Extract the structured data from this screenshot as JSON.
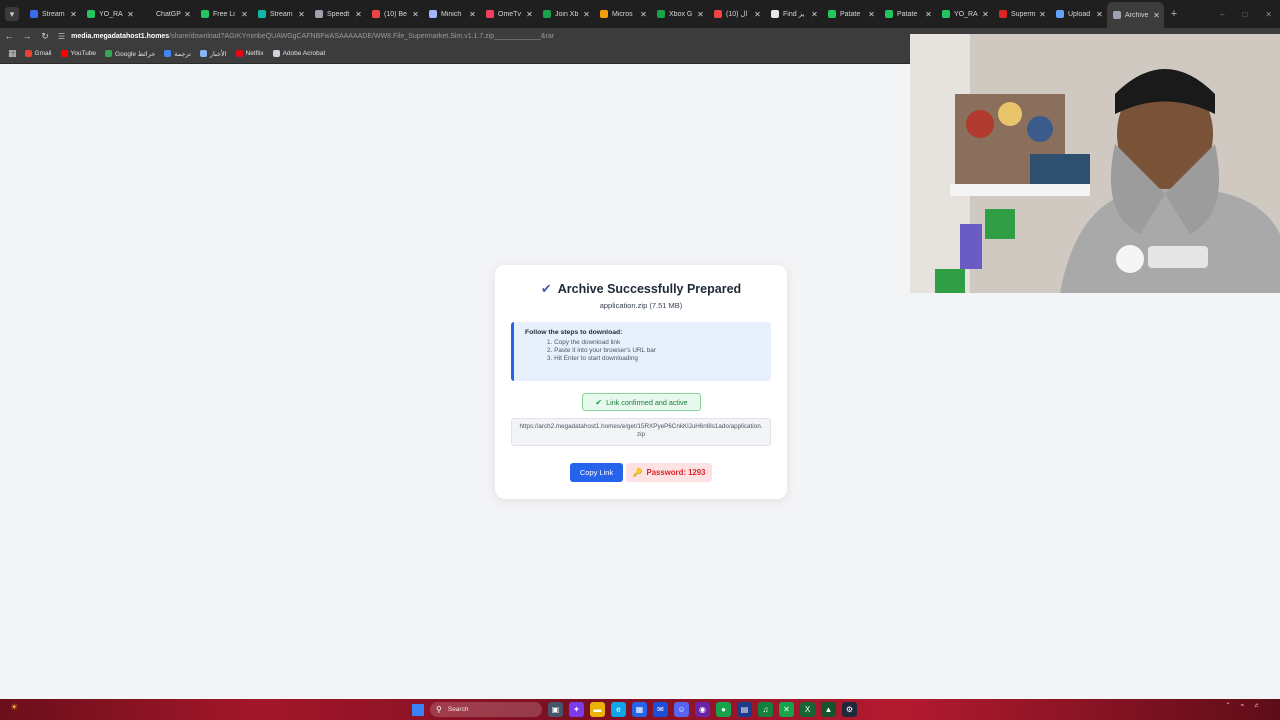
{
  "browser": {
    "tabs": [
      {
        "title": "Stream",
        "color": "#3b6cf0"
      },
      {
        "title": "YO_RA",
        "color": "#22c55e"
      },
      {
        "title": "ChatGP",
        "color": "#1f1f1f"
      },
      {
        "title": "Free Li",
        "color": "#22c55e"
      },
      {
        "title": "Stream",
        "color": "#14b8a6"
      },
      {
        "title": "Speedt",
        "color": "#9ca3af"
      },
      {
        "title": "(10) Be",
        "color": "#ef4444"
      },
      {
        "title": "Minich",
        "color": "#a5b4fc"
      },
      {
        "title": "OmeTv",
        "color": "#f43f5e"
      },
      {
        "title": "Join Xb",
        "color": "#16a34a"
      },
      {
        "title": "Micros",
        "color": "#f59e0b"
      },
      {
        "title": "Xbox G",
        "color": "#16a34a"
      },
      {
        "title": "ال (10)",
        "color": "#ef4444"
      },
      {
        "title": "Find يز",
        "color": "#e5e7eb"
      },
      {
        "title": "Patate",
        "color": "#22c55e"
      },
      {
        "title": "Patate",
        "color": "#22c55e"
      },
      {
        "title": "YO_RA",
        "color": "#22c55e"
      },
      {
        "title": "Superm",
        "color": "#dc2626"
      },
      {
        "title": "Upload",
        "color": "#60a5fa"
      },
      {
        "title": "Archive",
        "color": "#9ca3af",
        "active": true
      }
    ],
    "new_tab_label": "+",
    "window_controls": {
      "minimize": "–",
      "maximize": "□",
      "close": "✕"
    },
    "address": {
      "host": "media.megadatahost1.homes",
      "path": "/share/download?AGrKYmmbeQUAWGgCAFNBFwASAAAAADE/WW8.File_Supermarket.Sim.v1.1.7.zip____________&rar"
    },
    "bookmarks": [
      {
        "label": "Gmail",
        "color": "#ea4335"
      },
      {
        "label": "YouTube",
        "color": "#ff0000"
      },
      {
        "label": "Google خرائط",
        "color": "#34a853"
      },
      {
        "label": "ترجمة",
        "color": "#4285f4"
      },
      {
        "label": "الأخبار",
        "color": "#8ab4f8"
      },
      {
        "label": "Netflix",
        "color": "#e50914"
      },
      {
        "label": "Adobe Acrobat",
        "color": "#d1d5db"
      }
    ]
  },
  "card": {
    "title": "Archive Successfully Prepared",
    "file_info": "application.zip (7.51 MB)",
    "steps_heading": "Follow the steps to download:",
    "steps": [
      "1. Copy the download link",
      "2. Paste it into your browser's URL bar",
      "3. Hit Enter to start downloading"
    ],
    "confirm_text": "Link confirmed and active",
    "download_link": "https://arch2.megadatahost1.homes/e/get/15RXPyeP6CnkKlJuH6nl8s1ado/application.zip",
    "copy_button": "Copy Link",
    "password_text": "Password: 1293"
  },
  "taskbar": {
    "search_placeholder": "Search",
    "apps": [
      {
        "name": "task-view-icon",
        "glyph": "▣",
        "color": "#475569"
      },
      {
        "name": "copilot-icon",
        "glyph": "✦",
        "color": "#7c3aed"
      },
      {
        "name": "file-explorer-icon",
        "glyph": "▬",
        "color": "#eab308"
      },
      {
        "name": "edge-icon",
        "glyph": "e",
        "color": "#0ea5e9"
      },
      {
        "name": "store-icon",
        "glyph": "▦",
        "color": "#2563eb"
      },
      {
        "name": "mail-icon",
        "glyph": "✉",
        "color": "#1d4ed8"
      },
      {
        "name": "discord-icon",
        "glyph": "☺",
        "color": "#5865f2"
      },
      {
        "name": "obs-icon",
        "glyph": "◉",
        "color": "#6b21a8"
      },
      {
        "name": "chrome-icon",
        "glyph": "●",
        "color": "#16a34a"
      },
      {
        "name": "calculator-icon",
        "glyph": "▤",
        "color": "#1e3a8a"
      },
      {
        "name": "spotify-icon",
        "glyph": "♫",
        "color": "#15803d"
      },
      {
        "name": "xbox-icon",
        "glyph": "✕",
        "color": "#16a34a"
      },
      {
        "name": "excel-icon",
        "glyph": "X",
        "color": "#166534"
      },
      {
        "name": "game-icon",
        "glyph": "▲",
        "color": "#14532d"
      },
      {
        "name": "steam-icon",
        "glyph": "⚙",
        "color": "#1e293b"
      }
    ]
  }
}
